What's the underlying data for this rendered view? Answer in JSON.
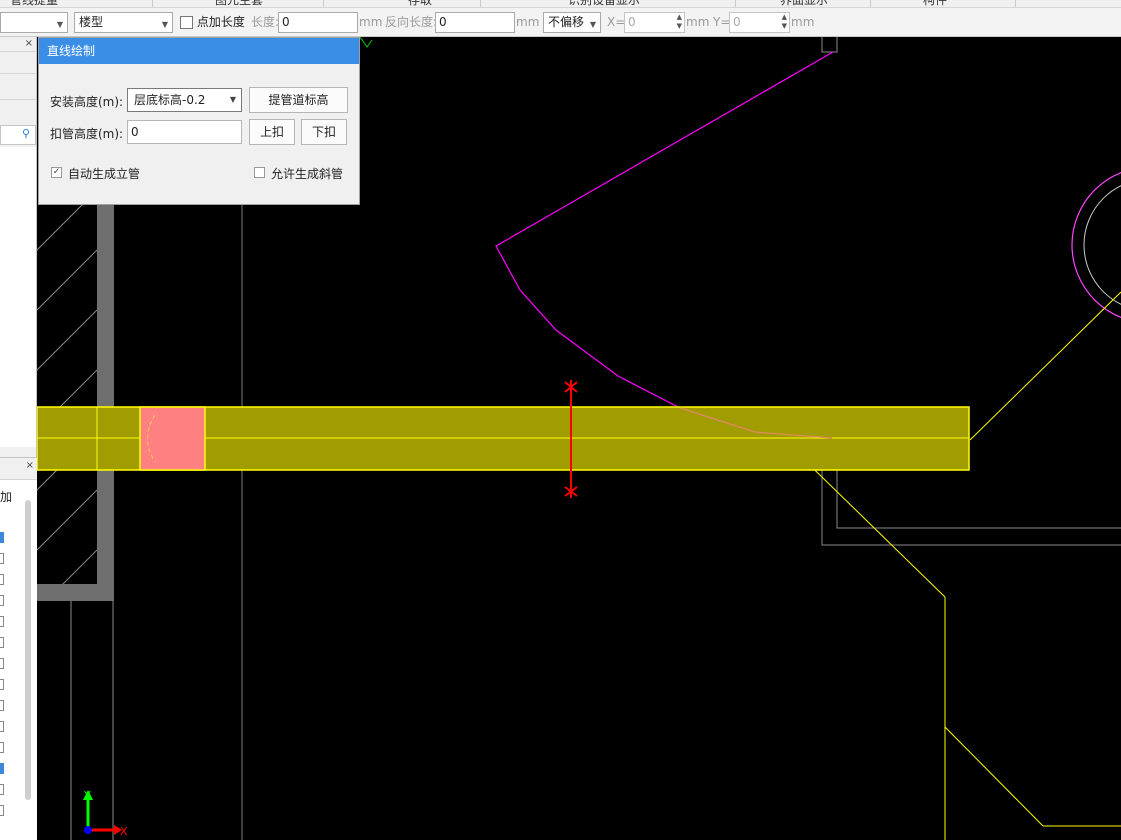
{
  "top_strip": {
    "cut_labels": [
      "管线提量",
      "图元主套",
      "存取",
      "识别设备显示",
      "界面显示",
      "构件"
    ]
  },
  "toolbar": {
    "dropdown1_value": "",
    "dropdown2_value": "楼型",
    "point_length_label": "点加长度",
    "length_label": "长度:",
    "length_value": "0",
    "unit_mm": "mm",
    "reverse_length_label": "反向长度:",
    "reverse_length_value": "0",
    "offset_value": "不偏移",
    "x_label": "X=",
    "x_value": "0",
    "y_label": "Y=",
    "y_value": "0"
  },
  "left_panel": {
    "close1": "×",
    "close2": "×",
    "partial_text": "加",
    "search_icon": "search-icon"
  },
  "dialog": {
    "title": "直线绘制",
    "install_height_label": "安装高度(m):",
    "install_height_value": "层底标高-0.2",
    "pipe_elev_button": "提管道标高",
    "deduct_height_label": "扣管高度(m):",
    "deduct_height_value": "0",
    "up_button": "上扣",
    "down_button": "下扣",
    "auto_riser_label": "自动生成立管",
    "auto_riser_checked": true,
    "allow_slope_label": "允许生成斜管",
    "allow_slope_checked": false
  },
  "canvas": {
    "background": "#000000",
    "pipe_color": "#a19c00",
    "pipe_edge_color": "#ffff00",
    "fitting_color": "#ff8080",
    "magenta_line_color": "#ff00ff",
    "marker_color": "#ff0000",
    "axis_y_label": "Y",
    "axis_x_label": "X"
  }
}
